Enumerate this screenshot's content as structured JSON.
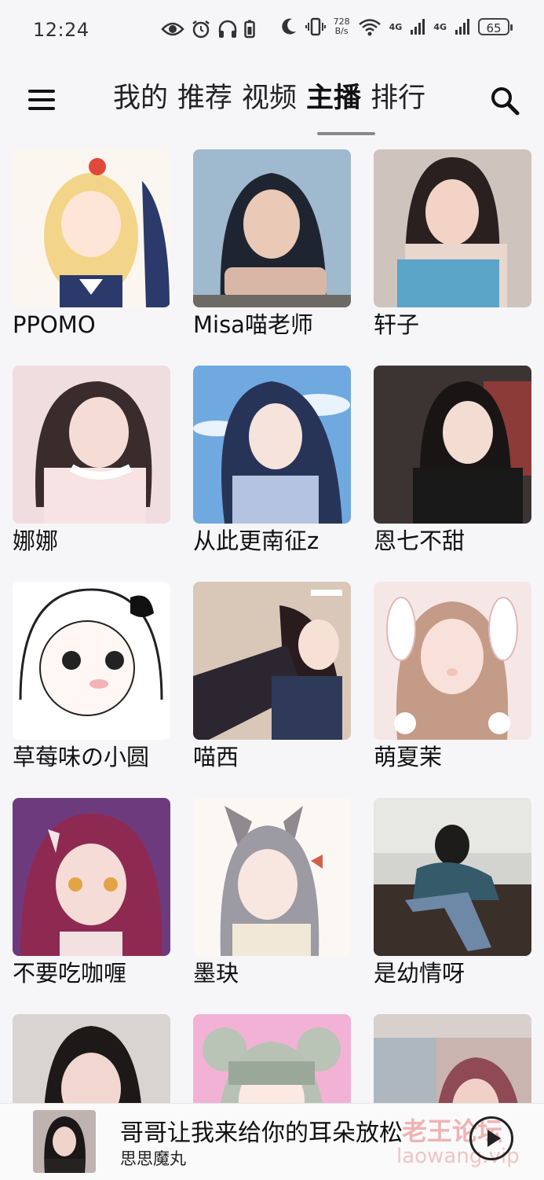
{
  "status_bar": {
    "time": "12:24",
    "net_speed_value": "728",
    "net_speed_unit": "B/s",
    "signal_1": "4G",
    "signal_2": "4G",
    "battery": "65",
    "left_icons": [
      "eye-icon",
      "alarm-icon",
      "headphones-icon",
      "battery-saver-icon"
    ],
    "right_icons": [
      "moon-icon",
      "vibrate-icon",
      "wifi-icon",
      "signal-icon",
      "signal-icon",
      "battery-icon"
    ]
  },
  "nav": {
    "tabs": [
      {
        "label": "我的",
        "active": false
      },
      {
        "label": "推荐",
        "active": false
      },
      {
        "label": "视频",
        "active": false
      },
      {
        "label": "主播",
        "active": true
      },
      {
        "label": "排行",
        "active": false
      }
    ],
    "icons": [
      "menu-icon",
      "search-icon"
    ]
  },
  "streamers": [
    {
      "name": "PPOMO"
    },
    {
      "name": "Misa喵老师"
    },
    {
      "name": "轩子"
    },
    {
      "name": "娜娜"
    },
    {
      "name": "从此更南征z"
    },
    {
      "name": "恩七不甜"
    },
    {
      "name": "草莓味の小圆"
    },
    {
      "name": "喵西"
    },
    {
      "name": "萌夏茉"
    },
    {
      "name": "不要吃咖喱"
    },
    {
      "name": "墨玦"
    },
    {
      "name": "是幼情呀"
    },
    {
      "name": ""
    },
    {
      "name": ""
    },
    {
      "name": ""
    }
  ],
  "player": {
    "title": "哥哥让我来给你的耳朵放松",
    "artist": "思思魔丸",
    "play_icon": "play-icon"
  },
  "watermark": {
    "text": "老王论坛",
    "url": "laowang.vip"
  },
  "colors": {
    "background": "#f6f6f8",
    "text": "#111111",
    "tab_underline": "#888888"
  }
}
